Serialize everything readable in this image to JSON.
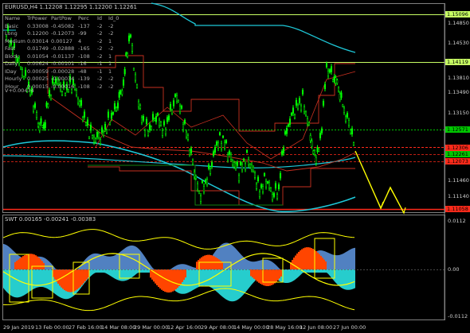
{
  "header": {
    "symbol": "EURUSD,H4",
    "ohlc": "1.12208 1.12295 1.12200 1.12261"
  },
  "table": {
    "columns": [
      "Name",
      "TrPower",
      "PartPow",
      "Perc",
      "Id",
      "Id_0"
    ],
    "rows": [
      [
        "Basic",
        "0.33008",
        "-0.45082",
        "-137",
        "-2",
        "-2"
      ],
      [
        "Long",
        "0.12200",
        "-0.12073",
        "-99",
        "-2",
        "-2"
      ],
      [
        "Medium",
        "0.03014",
        "0.00127",
        "4",
        "-2",
        "1"
      ],
      [
        "Fast",
        "0.01749",
        "-0.02888",
        "-165",
        "-2",
        "-2"
      ],
      [
        "Block",
        "0.01054",
        "-0.01137",
        "-108",
        "-2",
        "1"
      ],
      [
        "Daily",
        "0.00624",
        "-0.00101",
        "-16",
        "-1",
        "1"
      ],
      [
        "IDay",
        "0.00059",
        "-0.00028",
        "-48",
        "-1",
        "1"
      ],
      [
        "Hourly",
        "0.00025",
        "-0.00034",
        "-139",
        "-2",
        "-2"
      ],
      [
        "IHour",
        "0.00015",
        "-0.00016",
        "-108",
        "-2",
        "-2"
      ]
    ],
    "footer": "V+0.00474"
  },
  "main_price_labels": {
    "p1": "1.15096",
    "p2": "1.14850",
    "p3": "1.14530",
    "p4": "1.14195",
    "p5": "1.14119",
    "p6": "1.13810",
    "p7": "1.13490",
    "p8": "1.13150",
    "p9": "1.12830",
    "p10": "1.12571",
    "p11": "1.12163",
    "p12": "1.11460",
    "p13": "1.11140",
    "p14": "1.10820"
  },
  "price_tags": {
    "top": "1.15096",
    "mid": "1.14119",
    "g1": "1.12571",
    "g2": "1.12261",
    "r1": "1.12306",
    "r2": "1.12073",
    "low": "1.11058"
  },
  "sub_header": "SWT 0.00165 -0.00241 -0.00383",
  "sub_price_labels": {
    "top": "0.0112",
    "zero": "0.00",
    "bottom": "-0.0112"
  },
  "dates": [
    "29 Jan 2019",
    "13 Feb 00:00",
    "27 Feb 16:00",
    "14 Mar 08:00",
    "29 Mar 00:00",
    "12 Apr 16:00",
    "29 Apr 08:00",
    "14 May 00:00",
    "28 May 16:00",
    "12 Jun 08:00",
    "27 Jun 00:00"
  ],
  "colors": {
    "candles": "#00ff00",
    "cyan_band": "#1ec8d8",
    "red_line": "#ff2a1a",
    "yellow": "#ffff00",
    "orange_hist": "#ff4500",
    "blue_hist": "#5a8fd6",
    "cyan_hist": "#28d8d8",
    "top_level": "#c8ff64",
    "price_tag_green": "#00c800",
    "price_tag_red": "#ff2a1a"
  }
}
